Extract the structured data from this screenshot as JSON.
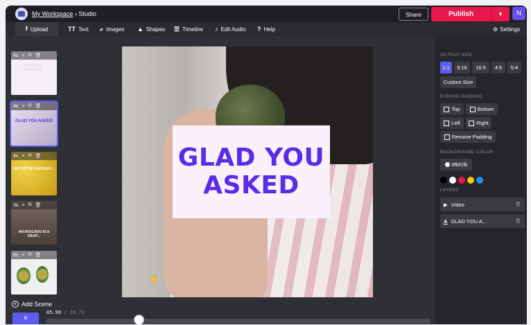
{
  "header": {
    "workspace": "My Workspace",
    "separator": "›",
    "page": "Studio",
    "share_label": "Share",
    "publish_label": "Publish",
    "avatar_initial": "N"
  },
  "toolbar": {
    "upload": "Upload",
    "text": "Text",
    "images": "Images",
    "shapes": "Shapes",
    "timeline": "Timeline",
    "edit_audio": "Edit Audio",
    "help": "Help",
    "settings": "Settings"
  },
  "scenes": [
    {
      "duration": "4s",
      "caption": "THERE ARE... AVOCADO...",
      "bg": "#f6eef6"
    },
    {
      "duration": "4s",
      "caption": "GLAD YOU ASKED",
      "bg": "#d8d2e6"
    },
    {
      "duration": "4s",
      "caption": "WHY IS THE AVOCADO...",
      "bg": "#e8c22a"
    },
    {
      "duration": "3s",
      "caption": "AN AVOCADO IS A FRUIT...",
      "bg": "#6a5a50"
    },
    {
      "duration": "8s",
      "caption": "",
      "bg": "#f2f2f2"
    }
  ],
  "add_scene": "Add Scene",
  "canvas": {
    "line1": "GLAD YOU",
    "line2": "ASKED"
  },
  "right_panel": {
    "output_size_title": "OUTPUT SIZE",
    "sizes": [
      "1:1",
      "9:16",
      "16:9",
      "4:5",
      "5:4"
    ],
    "selected_size": "1:1",
    "custom_size": "Custom Size",
    "expand_padding_title": "EXPAND PADDING",
    "top": "Top",
    "bottom": "Bottom",
    "left": "Left",
    "right": "Right",
    "remove_padding": "Remove Padding",
    "background_color_title": "BACKGROUND COLOR",
    "background_color": "#fbf1fb",
    "swatches": [
      "#000000",
      "#ffffff",
      "#e8184d",
      "#f5c800",
      "#1d8ff0"
    ],
    "layers_title": "LAYERS",
    "layers": [
      {
        "label": "Video",
        "icon": "play-icon"
      },
      {
        "label": "GLAD YOU A...",
        "icon": "text-layer-icon"
      }
    ]
  },
  "timeline": {
    "current": "05.99",
    "slash": "/",
    "total": "24.72",
    "progress": 0.242
  },
  "colors": {
    "accent": "#5b5cf0",
    "publish": "#e8184d",
    "text_purple": "#5b2be8"
  }
}
